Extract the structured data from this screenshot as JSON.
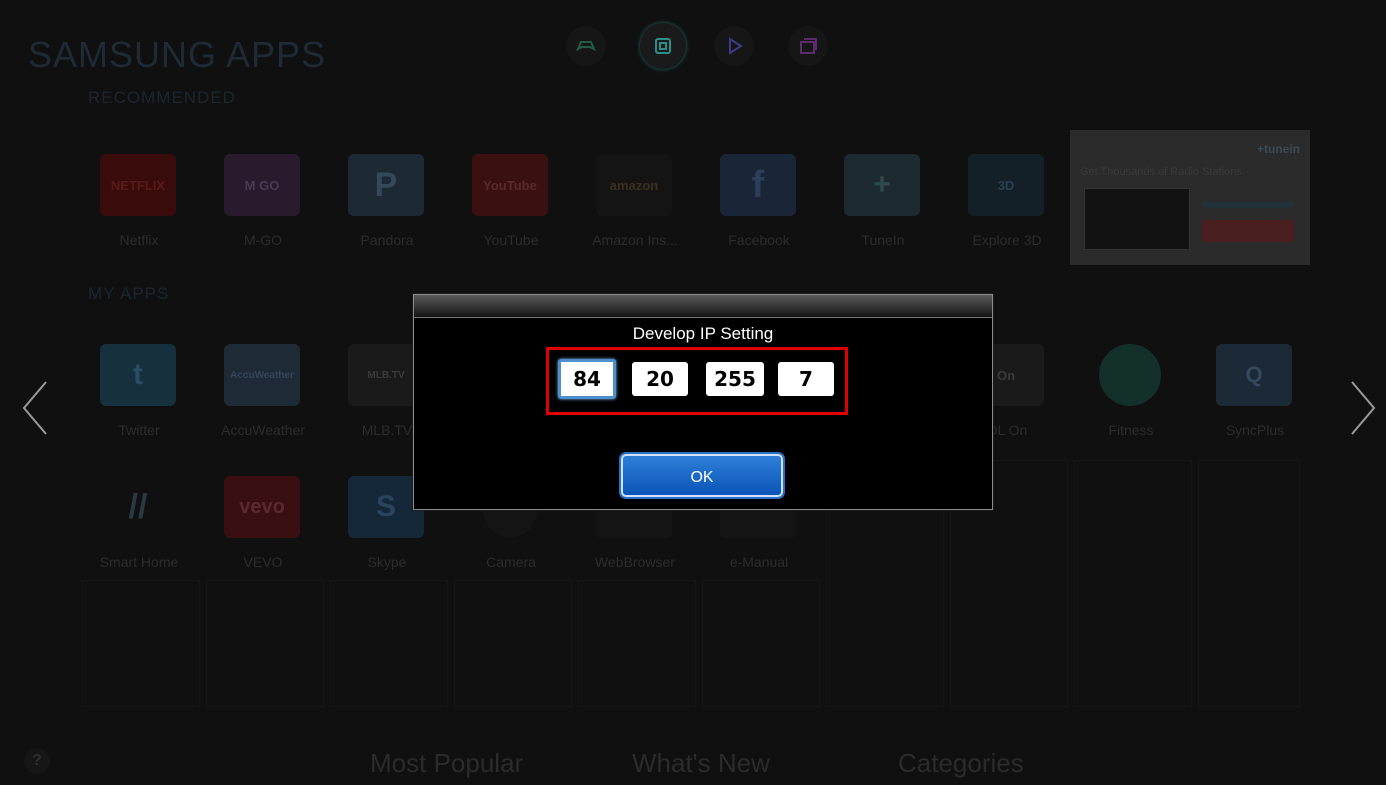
{
  "brand": "SAMSUNG APPS",
  "sections": {
    "recommended": "RECOMMENDED",
    "my_apps": "MY APPS"
  },
  "hub_icons": [
    "game-icon",
    "apps-icon",
    "play-icon",
    "multiscreen-icon"
  ],
  "recommended": [
    {
      "label": "Netflix",
      "logo": "NETFLIX",
      "color": "#3a0b0b"
    },
    {
      "label": "M-GO",
      "logo": "M GO",
      "color": "#2a1a2e"
    },
    {
      "label": "Pandora",
      "logo": "P",
      "color": "#1d2a35"
    },
    {
      "label": "YouTube",
      "logo": "YouTube",
      "color": "#3a1010"
    },
    {
      "label": "Amazon Ins...",
      "logo": "amazon",
      "color": "#141414"
    },
    {
      "label": "Facebook",
      "logo": "f",
      "color": "#1a2538"
    },
    {
      "label": "TuneIn",
      "logo": "+",
      "color": "#1d2a30"
    },
    {
      "label": "Explore 3D",
      "logo": "3D",
      "color": "#142028"
    }
  ],
  "tunein_ad": {
    "brand": "+tunein",
    "tagline": "Get Thousands of Radio Stations"
  },
  "my_apps": [
    {
      "label": "Twitter",
      "logo": "t",
      "color": "#16303e"
    },
    {
      "label": "AccuWeather",
      "logo": "AccuWeather",
      "color": "#1e2a36"
    },
    {
      "label": "MLB.TV",
      "logo": "MLB.TV",
      "color": "#1a1a1a"
    },
    {
      "label": "OL On",
      "logo": "On",
      "color": "#1a1a1a"
    },
    {
      "label": "Fitness",
      "logo": "",
      "color": "#14302a"
    },
    {
      "label": "SyncPlus",
      "logo": "Q",
      "color": "#1c2a38"
    },
    {
      "label": "Smart Home",
      "logo": "//",
      "color": "#141e24"
    },
    {
      "label": "VEVO",
      "logo": "vevo",
      "color": "#3a0f12"
    },
    {
      "label": "Skype",
      "logo": "S",
      "color": "#14283a"
    },
    {
      "label": "Camera",
      "logo": "",
      "color": "#141414"
    },
    {
      "label": "WebBrowser",
      "logo": "",
      "color": "#141414"
    },
    {
      "label": "e-Manual",
      "logo": "",
      "color": "#141414"
    }
  ],
  "bottom_nav": [
    "Most Popular",
    "What's New",
    "Categories"
  ],
  "help": "?",
  "dialog": {
    "title": "Develop IP Setting",
    "octets": [
      "84",
      "20",
      "255",
      "7"
    ],
    "ok": "OK",
    "accent": "#e00000",
    "button_color": "#0a55b8"
  }
}
